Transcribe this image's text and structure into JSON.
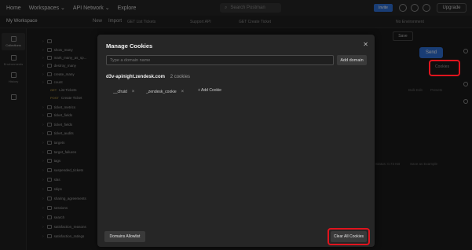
{
  "topbar": {
    "nav": [
      "Home",
      "Workspaces ⌄",
      "API Network ⌄",
      "Explore"
    ],
    "search_placeholder": "Search Postman",
    "invite_label": "Invite",
    "upgrade_label": "Upgrade"
  },
  "workspace": {
    "title": "My Workspace",
    "new_label": "New",
    "import_label": "Import",
    "tabs": [
      "GET List Tickets",
      "Support API",
      "GET Create Ticket"
    ],
    "env_label": "No Environment"
  },
  "rail": [
    {
      "label": "Collections",
      "active": true
    },
    {
      "label": "Environments",
      "active": false
    },
    {
      "label": "History",
      "active": false
    },
    {
      "label": "",
      "active": false
    }
  ],
  "tree": {
    "items": [
      {
        "kind": "folder",
        "label": ""
      },
      {
        "kind": "folder",
        "label": "show_many"
      },
      {
        "kind": "folder",
        "label": "mark_many_as_sp..."
      },
      {
        "kind": "folder",
        "label": "destroy_many"
      },
      {
        "kind": "folder",
        "label": "create_many"
      },
      {
        "kind": "folder",
        "label": "count"
      },
      {
        "kind": "request",
        "method": "GET",
        "label": "List Tickets"
      },
      {
        "kind": "request",
        "method": "POST",
        "label": "Create Ticket"
      },
      {
        "kind": "folder",
        "label": "ticket_metrics"
      },
      {
        "kind": "folder",
        "label": "ticket_fields"
      },
      {
        "kind": "folder",
        "label": "ticket_fields"
      },
      {
        "kind": "folder",
        "label": "ticket_audits"
      },
      {
        "kind": "folder",
        "label": "targets"
      },
      {
        "kind": "folder",
        "label": "target_failures"
      },
      {
        "kind": "folder",
        "label": "tags"
      },
      {
        "kind": "folder",
        "label": "suspended_tickets"
      },
      {
        "kind": "folder",
        "label": "slas"
      },
      {
        "kind": "folder",
        "label": "skips"
      },
      {
        "kind": "folder",
        "label": "sharing_agreements"
      },
      {
        "kind": "folder",
        "label": "sessions"
      },
      {
        "kind": "folder",
        "label": "search"
      },
      {
        "kind": "folder",
        "label": "satisfaction_reasons"
      },
      {
        "kind": "folder",
        "label": "satisfaction_ratings"
      }
    ]
  },
  "right": {
    "save_label": "Save",
    "send_label": "Send",
    "cookies_label": "Cookies",
    "bulk_edit": "Bulk Edit",
    "presets": "Presets",
    "status": "Status: 0.73 KB",
    "save_example": "Save as Example"
  },
  "modal": {
    "title": "Manage Cookies",
    "domain_placeholder": "Type a domain name",
    "add_domain_label": "Add domain",
    "domain_name": "d3v-apinight.zendesk.com",
    "domain_count": "2 cookies",
    "cookies": [
      "__cfruid",
      "_zendesk_cookie"
    ],
    "add_cookie_label": "+ Add Cookie",
    "allowlist_label": "Domains Allowlist",
    "clear_all_label": "Clear All Cookies"
  },
  "colors": {
    "accent": "#2f6fd6",
    "highlight": "#e0141e"
  }
}
